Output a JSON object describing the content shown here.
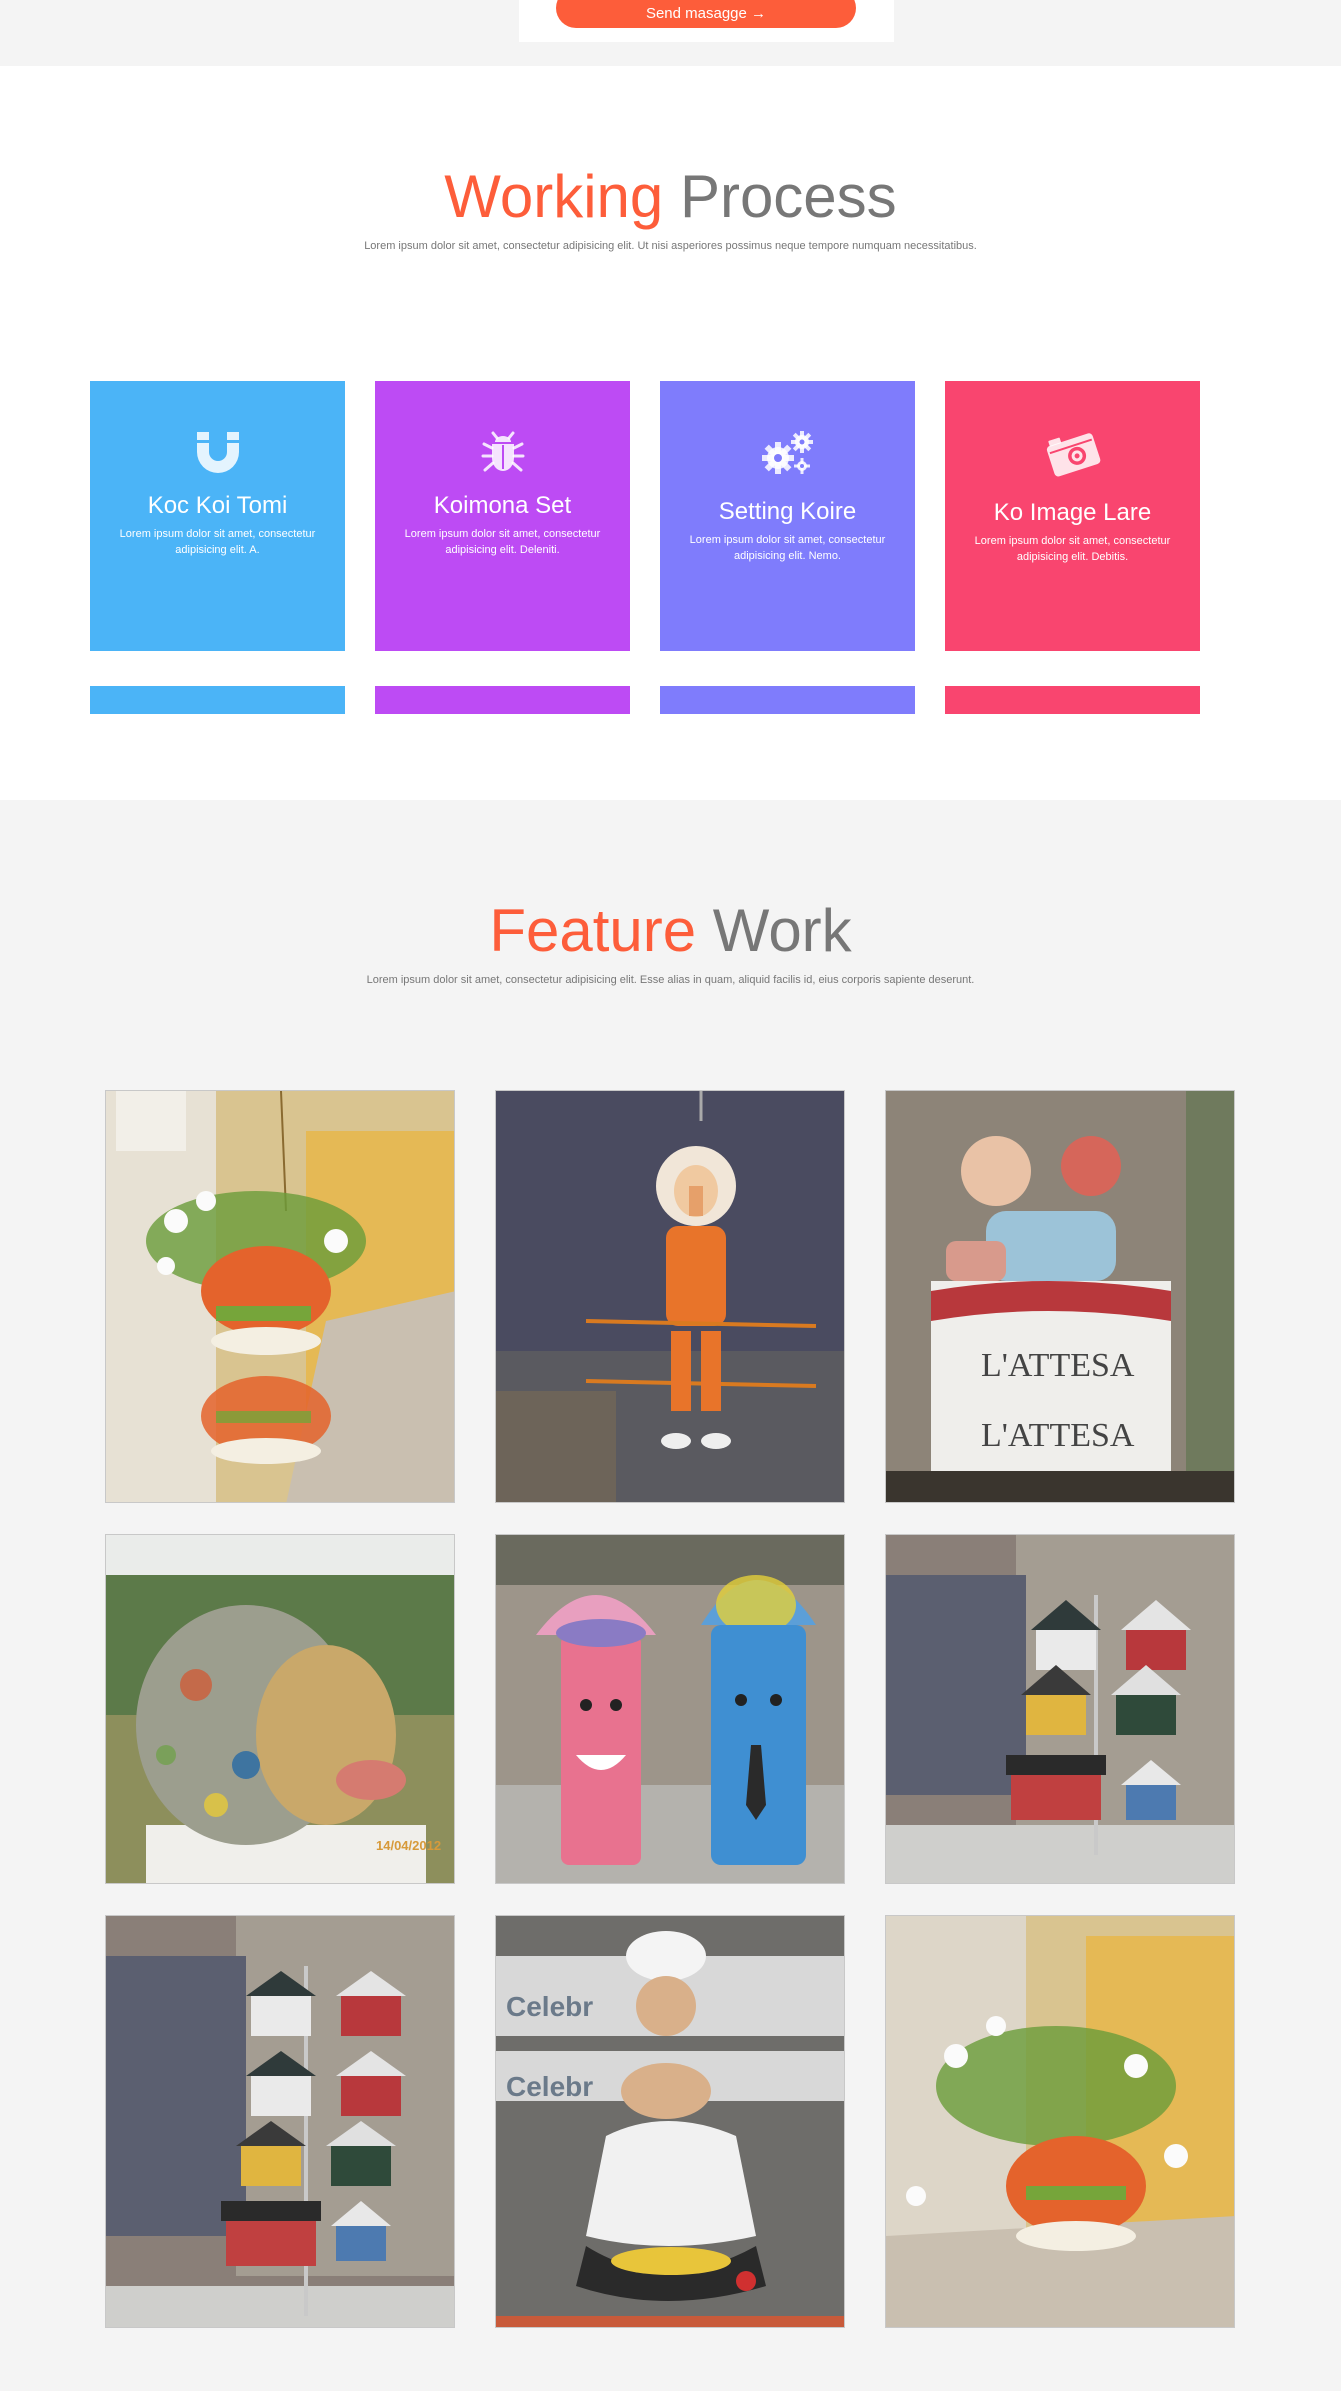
{
  "contact": {
    "send_label": "Send masagge →"
  },
  "process": {
    "title_accent": "Working",
    "title_rest": "Process",
    "subtitle": "Lorem ipsum dolor sit amet, consectetur adipisicing elit. Ut nisi asperiores possimus neque tempore numquam necessitatibus.",
    "cards": [
      {
        "icon": "magnet-icon",
        "title": "Koc Koi Tomi",
        "text": "Lorem ipsum dolor sit amet, consectetur adipisicing elit. A.",
        "color": "#4bb4f7"
      },
      {
        "icon": "bug-icon",
        "title": "Koimona Set",
        "text": "Lorem ipsum dolor sit amet, consectetur adipisicing elit. Deleniti.",
        "color": "#bd4bf4"
      },
      {
        "icon": "gears-icon",
        "title": "Setting Koire",
        "text": "Lorem ipsum dolor sit amet, consectetur adipisicing elit. Nemo.",
        "color": "#7f7cfc"
      },
      {
        "icon": "camera-icon",
        "title": "Ko Image Lare",
        "text": "Lorem ipsum dolor sit amet, consectetur adipisicing elit. Debitis.",
        "color": "#f9456f"
      }
    ]
  },
  "feature": {
    "title_accent": "Feature",
    "title_rest": "Work",
    "subtitle": "Lorem ipsum dolor sit amet, consectetur adipisicing elit. Esse alias in quam, aliquid facilis id, eius corporis sapiente deserunt.",
    "photos": [
      {
        "subject": "hanging teapot planter"
      },
      {
        "subject": "hanging clown puppet"
      },
      {
        "subject": "clown figures on cake",
        "caption_1": "L'ATTESA",
        "caption_2": "L'ATTESA"
      },
      {
        "subject": "mosaic fish sculpture",
        "stamp": "14/04/2012"
      },
      {
        "subject": "painted planter pots"
      },
      {
        "subject": "birdhouse display stand"
      },
      {
        "subject": "birdhouse display stand"
      },
      {
        "subject": "chef figurine",
        "caption_1": "Celebr",
        "caption_2": "Celebr"
      },
      {
        "subject": "hanging teapot planter"
      }
    ]
  }
}
